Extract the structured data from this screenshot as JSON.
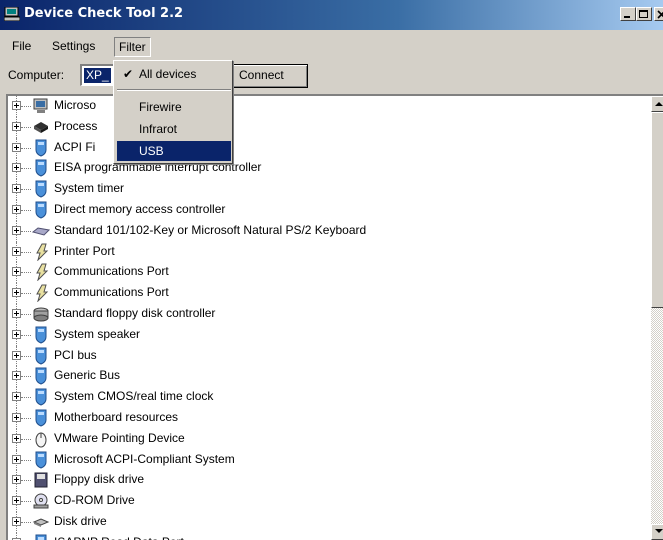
{
  "window": {
    "title": "Device Check Tool 2.2"
  },
  "menu": {
    "file": "File",
    "settings": "Settings",
    "filter": "Filter"
  },
  "toolbar": {
    "computer_label": "Computer:",
    "computer_value": "XP_",
    "connect_label": "Connect"
  },
  "filter_menu": {
    "items": [
      {
        "label": "All devices",
        "checked": true
      },
      {
        "label": "Firewire"
      },
      {
        "label": "Infrarot"
      },
      {
        "label": "USB",
        "highlighted": true
      }
    ]
  },
  "devices": [
    {
      "label": "Microso",
      "icon": "computer-icon"
    },
    {
      "label": "Process",
      "icon": "processor-icon"
    },
    {
      "label": "ACPI Fi",
      "icon": "device-icon"
    },
    {
      "label": "EISA programmable interrupt controller",
      "icon": "device-icon"
    },
    {
      "label": "System timer",
      "icon": "device-icon"
    },
    {
      "label": "Direct memory access controller",
      "icon": "device-icon"
    },
    {
      "label": "Standard 101/102-Key or Microsoft Natural PS/2 Keyboard",
      "icon": "keyboard-icon"
    },
    {
      "label": "Printer Port",
      "icon": "port-icon"
    },
    {
      "label": "Communications Port",
      "icon": "port-icon"
    },
    {
      "label": "Communications Port",
      "icon": "port-icon"
    },
    {
      "label": "Standard floppy disk controller",
      "icon": "floppy-controller-icon"
    },
    {
      "label": "System speaker",
      "icon": "device-icon"
    },
    {
      "label": "PCI bus",
      "icon": "device-icon"
    },
    {
      "label": "Generic Bus",
      "icon": "device-icon"
    },
    {
      "label": "System CMOS/real time clock",
      "icon": "device-icon"
    },
    {
      "label": "Motherboard resources",
      "icon": "device-icon"
    },
    {
      "label": "VMware Pointing Device",
      "icon": "mouse-icon"
    },
    {
      "label": "Microsoft ACPI-Compliant System",
      "icon": "device-icon"
    },
    {
      "label": "Floppy disk drive",
      "icon": "floppy-icon"
    },
    {
      "label": "CD-ROM Drive",
      "icon": "cdrom-icon"
    },
    {
      "label": "Disk drive",
      "icon": "disk-icon"
    },
    {
      "label": "ISAPNP Read Data Port",
      "icon": "device-icon"
    }
  ],
  "colors": {
    "selection": "#0a246a",
    "titlebar_start": "#0a246a",
    "titlebar_end": "#a6caf0",
    "face": "#d4d0c8"
  }
}
